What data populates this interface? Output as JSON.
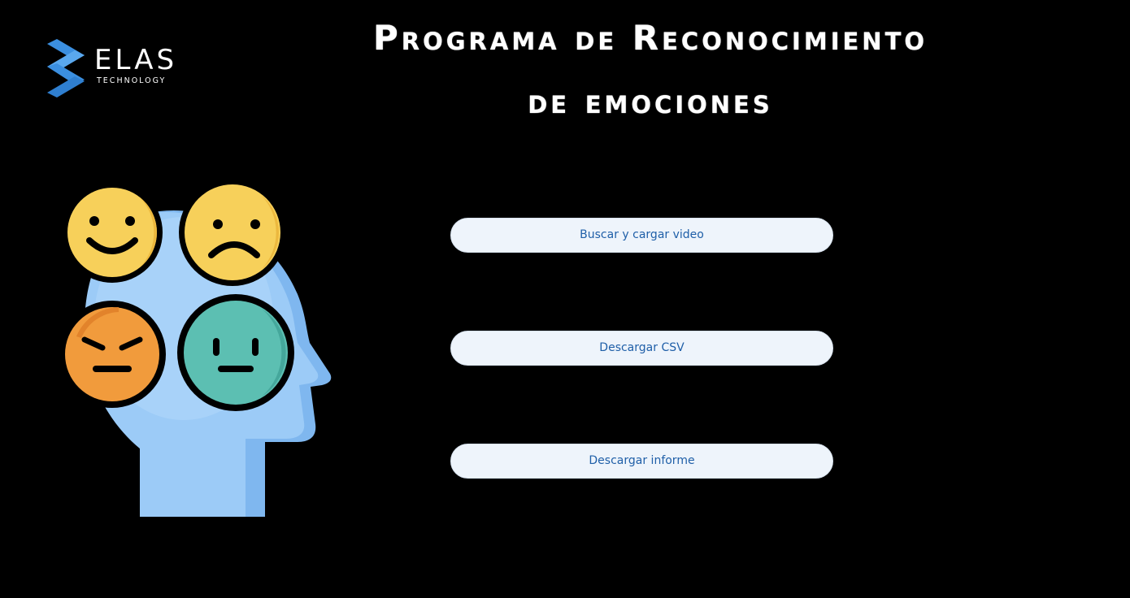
{
  "logo": {
    "name": "ELAS",
    "subtitle": "TECHNOLOGY",
    "accent_color": "#3b8fe0"
  },
  "header": {
    "title_line1": "Programa de Reconocimiento",
    "title_line2": "de emociones"
  },
  "illustration": {
    "icon": "head-with-emotions-icon",
    "faces": [
      "happy-face-icon",
      "sad-face-icon",
      "angry-face-icon",
      "neutral-face-icon"
    ]
  },
  "actions": {
    "load_video_label": "Buscar y cargar video",
    "download_csv_label": "Descargar CSV",
    "download_report_label": "Descargar informe"
  },
  "colors": {
    "background": "#000000",
    "button_bg": "#eef4fb",
    "button_text": "#1f5fa8",
    "head": "#8fc3f5",
    "happy": "#f7d05a",
    "angry": "#f19b3c",
    "neutral": "#5cbfb2"
  }
}
